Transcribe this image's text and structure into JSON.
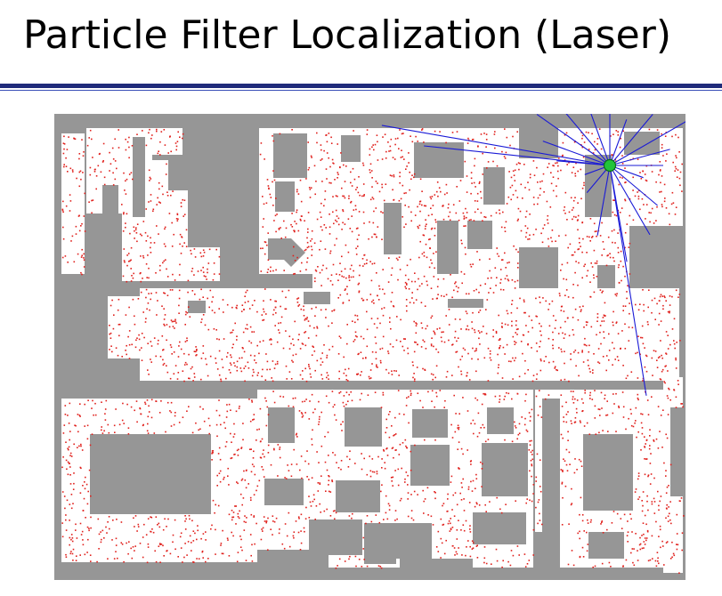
{
  "slide": {
    "title": "Particle Filter Localization (Laser)"
  },
  "colors": {
    "rule_primary": "#1f2a7a",
    "rule_secondary": "#3a4fb8",
    "map_wall": "#969696",
    "map_free": "#ffffff",
    "particle": "#e0201c",
    "laser_ray": "#1a1ad6",
    "robot": "#22c43a",
    "robot_outline": "#0a6b1a"
  },
  "map": {
    "name": "occupancy-grid-map",
    "particles_shown": true,
    "robot_shown": true,
    "laser_rays_shown": true
  }
}
